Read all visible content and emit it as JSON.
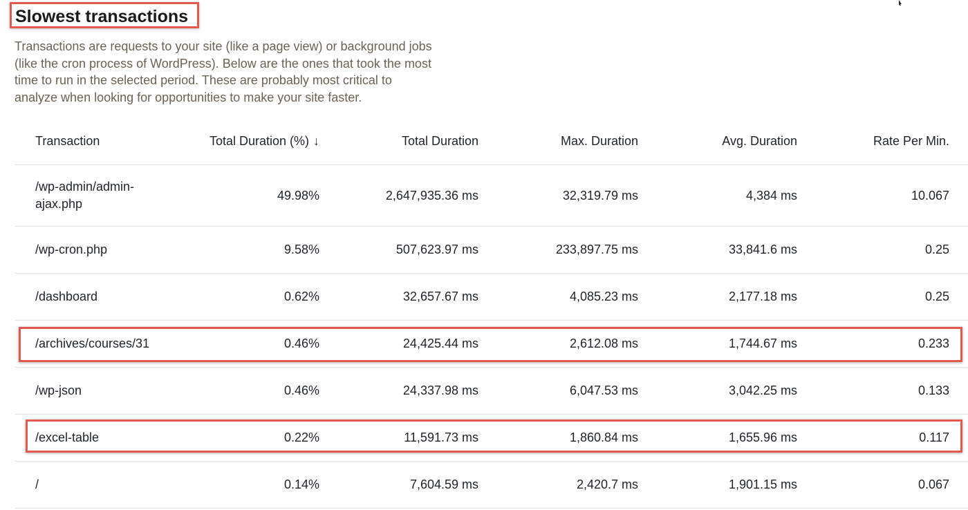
{
  "page": {
    "title": "Slowest transactions",
    "description": "Transactions are requests to your site (like a page view) or background jobs (like the cron process of WordPress). Below are the ones that took the most time to run in the selected period. These are probably most critical to analyze when looking for opportunities to make your site faster."
  },
  "table": {
    "columns": [
      "Transaction",
      "Total Duration (%)",
      "Total Duration",
      "Max. Duration",
      "Avg. Duration",
      "Rate Per Min."
    ],
    "sort_icon": "arrow-down-icon",
    "sort_glyph": "↓",
    "rows": [
      {
        "transaction": "/wp-admin/admin-ajax.php",
        "total_pct": "49.98%",
        "total": "2,647,935.36 ms",
        "max": "32,319.79 ms",
        "avg": "4,384 ms",
        "rate": "10.067"
      },
      {
        "transaction": "/wp-cron.php",
        "total_pct": "9.58%",
        "total": "507,623.97 ms",
        "max": "233,897.75 ms",
        "avg": "33,841.6 ms",
        "rate": "0.25"
      },
      {
        "transaction": "/dashboard",
        "total_pct": "0.62%",
        "total": "32,657.67 ms",
        "max": "4,085.23 ms",
        "avg": "2,177.18 ms",
        "rate": "0.25"
      },
      {
        "transaction": "/archives/courses/31",
        "total_pct": "0.46%",
        "total": "24,425.44 ms",
        "max": "2,612.08 ms",
        "avg": "1,744.67 ms",
        "rate": "0.233"
      },
      {
        "transaction": "/wp-json",
        "total_pct": "0.46%",
        "total": "24,337.98 ms",
        "max": "6,047.53 ms",
        "avg": "3,042.25 ms",
        "rate": "0.133"
      },
      {
        "transaction": "/excel-table",
        "total_pct": "0.22%",
        "total": "11,591.73 ms",
        "max": "1,860.84 ms",
        "avg": "1,655.96 ms",
        "rate": "0.117"
      },
      {
        "transaction": "/",
        "total_pct": "0.14%",
        "total": "7,604.59 ms",
        "max": "2,420.7 ms",
        "avg": "1,901.15 ms",
        "rate": "0.067"
      }
    ]
  },
  "annotations": {
    "highlight_color": "#e25a4e",
    "highlighted_rows": [
      "/archives/courses/31",
      "/excel-table"
    ]
  }
}
